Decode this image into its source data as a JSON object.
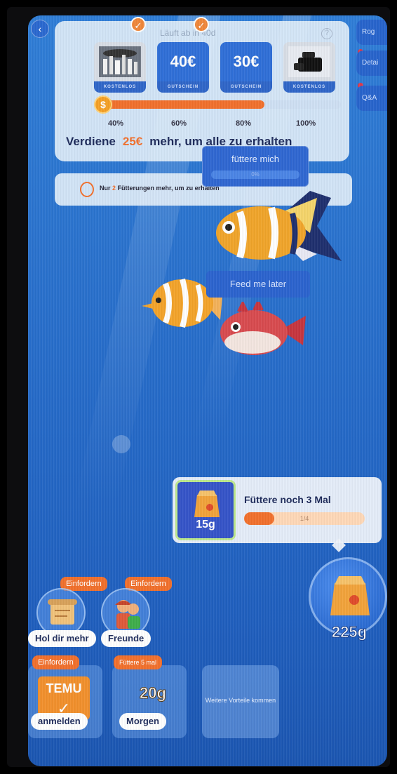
{
  "reward_card": {
    "timer_text": "Läuft ab in 40d",
    "tiles": [
      {
        "kind": "image",
        "band": "KOSTENLOS",
        "checked": true,
        "name": "city-skyline-product"
      },
      {
        "kind": "money",
        "value": "40€",
        "band": "GUTSCHEIN",
        "checked": true
      },
      {
        "kind": "money",
        "value": "30€",
        "band": "GUTSCHEIN",
        "checked": false
      },
      {
        "kind": "image",
        "band": "KOSTENLOS",
        "checked": false,
        "name": "black-device-product"
      }
    ],
    "progress_percent": 68,
    "milestones": [
      "40%",
      "60%",
      "80%",
      "100%"
    ],
    "earn_prefix": "Verdiene",
    "earn_amount": "25€",
    "earn_suffix": "mehr, um alle zu erhalten"
  },
  "notice": {
    "prefix": "Nur",
    "count": "2",
    "text": "Fütterungen mehr, um",
    "rest": "zu erhalten"
  },
  "feed_tooltip": {
    "label": "füttere mich",
    "bar_text": "0%"
  },
  "later_tooltip": {
    "label": "Feed me later"
  },
  "side_buttons": [
    "Rog",
    "Detai",
    "Q&A"
  ],
  "feed_card": {
    "food_amount": "15g",
    "title": "Füttere noch 3 Mal",
    "progress_text": "1/4",
    "progress_fraction": 0.25
  },
  "big_bag": {
    "amount": "225g"
  },
  "circles": [
    {
      "claim": "Einfordern",
      "label": "Hol dir mehr"
    },
    {
      "claim": "Einfordern",
      "label": "Freunde"
    }
  ],
  "boxes": [
    {
      "badge": "Einfordern",
      "brand": "TEMU",
      "button": "anmelden"
    },
    {
      "badge": "Füttere 5 mal",
      "amount": "20g",
      "button": "Morgen"
    }
  ],
  "more_card": {
    "text": "Weitere Vorteile kommen"
  },
  "colors": {
    "accent_orange": "#f2702c",
    "ocean_blue": "#2a73cf",
    "card_bg": "#e1eefa",
    "navy_text": "#1d2a5a"
  }
}
